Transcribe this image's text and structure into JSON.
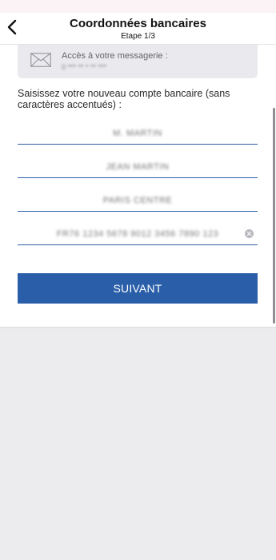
{
  "header": {
    "title": "Coordonnées bancaires",
    "step": "Etape 1/3"
  },
  "message_card": {
    "label": "Accès à votre messagerie :",
    "value": "0 *** ** * ** ***"
  },
  "form": {
    "instruction": "Saisissez votre nouveau compte bancaire (sans caractères accentués) :",
    "fields": [
      {
        "value": "M. MARTIN"
      },
      {
        "value": "JEAN MARTIN"
      },
      {
        "value": "PARIS CENTRE"
      },
      {
        "value": "FR76 1234 5678 9012 3456 7890 123"
      }
    ],
    "submit_label": "SUIVANT"
  },
  "colors": {
    "accent": "#2a5ea8",
    "underline": "#2f5fa5"
  },
  "icons": {
    "back": "chevron-left-icon",
    "message": "envelope-icon",
    "clear": "clear-circle-icon"
  }
}
